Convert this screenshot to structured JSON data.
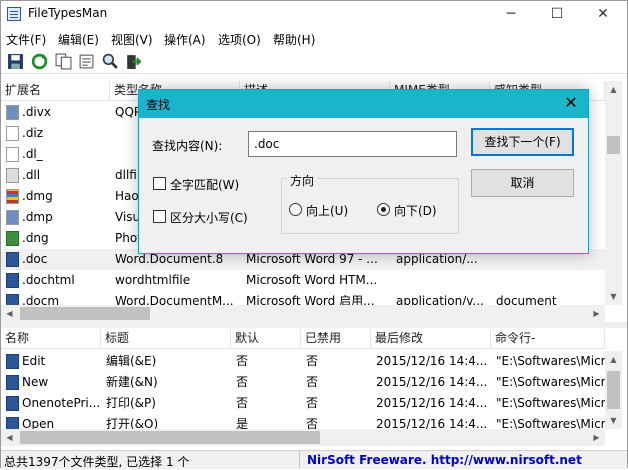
{
  "window": {
    "title": "FileTypesMan"
  },
  "menu": [
    "文件(F)",
    "编辑(E)",
    "视图(V)",
    "操作(A)",
    "选项(O)",
    "帮助(H)"
  ],
  "top_table": {
    "columns": [
      "扩展名",
      "类型名称",
      "描述",
      "MIME类型",
      "感知类型"
    ],
    "rows": [
      {
        "ext": ".divx",
        "type": "QQPl",
        "desc": "",
        "mime": "",
        "perceived": "",
        "icon": "app-file-icon"
      },
      {
        "ext": ".diz",
        "type": "",
        "desc": "",
        "mime": "",
        "perceived": "",
        "icon": "blank-file-icon"
      },
      {
        "ext": ".dl_",
        "type": "",
        "desc": "",
        "mime": "",
        "perceived": "",
        "icon": "blank-file-icon"
      },
      {
        "ext": ".dll",
        "type": "dllfil",
        "desc": "",
        "mime": "",
        "perceived": "",
        "icon": "gear-file-icon"
      },
      {
        "ext": ".dmg",
        "type": "Hao",
        "desc": "",
        "mime": "",
        "perceived": "",
        "icon": "archive-file-icon"
      },
      {
        "ext": ".dmp",
        "type": "Visu",
        "desc": "",
        "mime": "",
        "perceived": "",
        "icon": "app-file-icon"
      },
      {
        "ext": ".dng",
        "type": "Phot",
        "desc": "",
        "mime": "",
        "perceived": "",
        "icon": "image-file-icon"
      },
      {
        "ext": ".doc",
        "type": "Word.Document.8",
        "desc": "Microsoft Word 97 - ...",
        "mime": "application/...",
        "perceived": "",
        "icon": "word-file-icon"
      },
      {
        "ext": ".dochtml",
        "type": "wordhtmlfile",
        "desc": "Microsoft Word HTM...",
        "mime": "",
        "perceived": "",
        "icon": "word-file-icon"
      },
      {
        "ext": ".docm",
        "type": "Word.DocumentM...",
        "desc": "Microsoft Word 启用...",
        "mime": "application/v...",
        "perceived": "document",
        "icon": "word-file-icon"
      }
    ]
  },
  "bottom_table": {
    "columns": [
      "名称",
      "标题",
      "默认",
      "已禁用",
      "最后修改",
      "命令行-"
    ],
    "rows": [
      {
        "name": "Edit",
        "title": "编辑(&E)",
        "default": "否",
        "disabled": "否",
        "modified": "2015/12/16 14:4...",
        "cmd": "\"E:\\Softwares\\Micr"
      },
      {
        "name": "New",
        "title": "新建(&N)",
        "default": "否",
        "disabled": "否",
        "modified": "2015/12/16 14:4...",
        "cmd": "\"E:\\Softwares\\Micr"
      },
      {
        "name": "OnenotePri...",
        "title": "打印(&P)",
        "default": "否",
        "disabled": "否",
        "modified": "2015/12/16 14:4...",
        "cmd": "\"E:\\Softwares\\Micr"
      },
      {
        "name": "Open",
        "title": "打开(&O)",
        "default": "是",
        "disabled": "否",
        "modified": "2015/12/16 14:4...",
        "cmd": "\"E:\\Softwares\\Micr"
      }
    ]
  },
  "status": {
    "left": "总共1397个文件类型, 已选择 1 个",
    "right": "NirSoft Freeware.  http://www.nirsoft.net",
    "right_color": "#0000cc"
  },
  "find_dialog": {
    "title": "查找",
    "find_label": "查找内容(N):",
    "find_value": ".doc",
    "find_next_label": "查找下一个(F)",
    "cancel_label": "取消",
    "whole_word_label": "全字匹配(W)",
    "match_case_label": "区分大小写(C)",
    "direction_label": "方向",
    "up_label": "向上(U)",
    "down_label": "向下(D)",
    "direction_selected": "down",
    "title_color": "#1bb4cc"
  }
}
